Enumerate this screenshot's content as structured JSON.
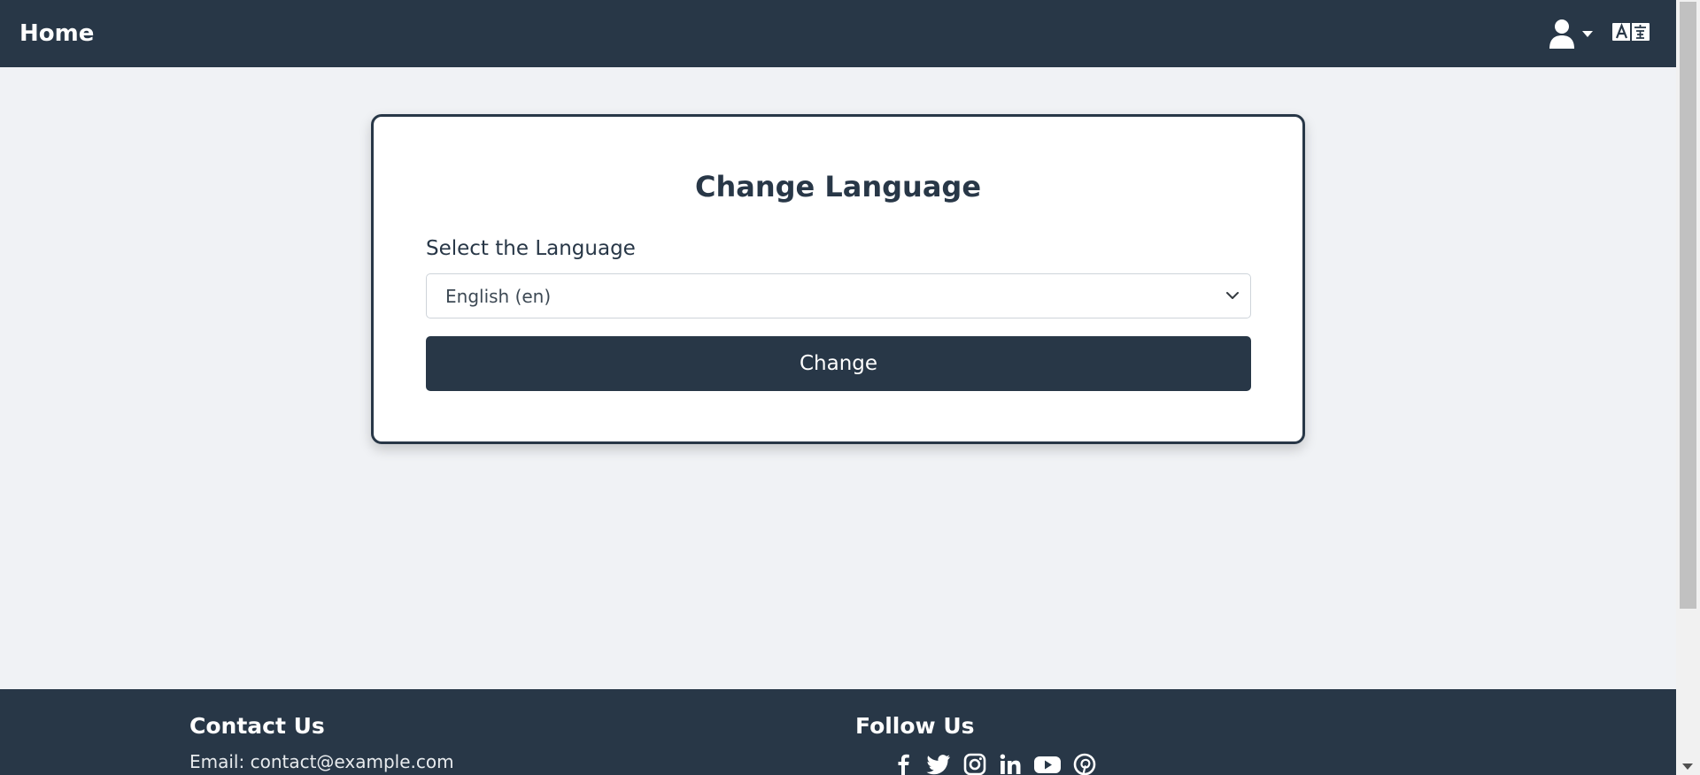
{
  "navbar": {
    "brand": "Home",
    "user_icon": "user-icon",
    "translate_icon": "translate-icon"
  },
  "card": {
    "title": "Change Language",
    "label": "Select the Language",
    "select_value": "English (en)",
    "button": "Change"
  },
  "footer": {
    "contact_title": "Contact Us",
    "email": "Email: contact@example.com",
    "follow_title": "Follow Us",
    "social_icons": [
      "facebook-icon",
      "twitter-icon",
      "instagram-icon",
      "linkedin-icon",
      "youtube-icon",
      "pinterest-icon"
    ]
  },
  "colors": {
    "primary": "#283747",
    "background": "#f0f2f5",
    "card": "#ffffff"
  }
}
